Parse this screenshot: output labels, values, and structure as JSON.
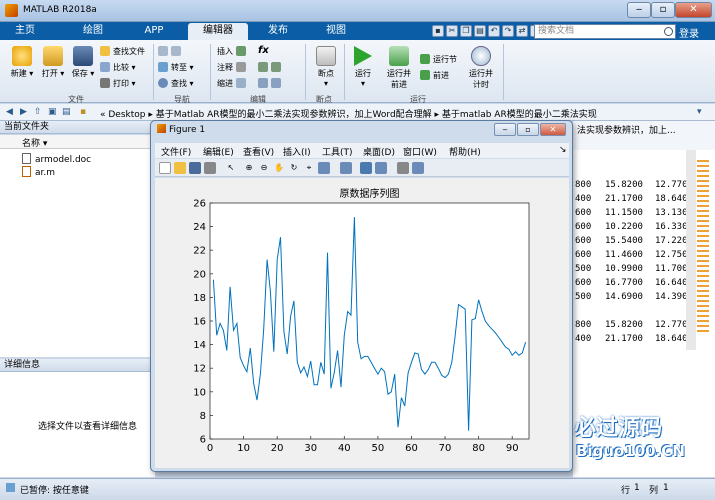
{
  "app": {
    "title": "MATLAB R2018a",
    "login": "登录",
    "search_placeholder": "搜索文档"
  },
  "tabs": [
    "主页",
    "绘图",
    "APP",
    "编辑器",
    "发布",
    "视图"
  ],
  "active_tab": "编辑器",
  "ribbon": {
    "new": "新建",
    "open": "打开",
    "save": "保存",
    "find_files": "查找文件",
    "compare": "比较",
    "print": "打印",
    "goto": "转至",
    "find": "查找",
    "insert": "插入",
    "comment": "注释",
    "indent": "缩进",
    "fx": "fx",
    "breakpoint": "断点",
    "run": "运行",
    "run_advance": "运行并\n前进",
    "run_section": "运行节",
    "advance": "前进",
    "run_time": "运行并\n计时",
    "groups": {
      "file": "文件",
      "nav": "导航",
      "edit": "编辑",
      "breakpoint": "断点",
      "run": "运行"
    }
  },
  "address": "« Desktop ▸ 基于Matlab AR模型的最小二乘法实现参数辨识，加上Word配合理解 ▸ 基于matlab AR模型的最小二乘法实现",
  "current_folder": {
    "title": "当前文件夹",
    "col_name": "名称 ▾",
    "files": [
      "armodel.doc",
      "ar.m"
    ]
  },
  "details": {
    "title": "详细信息",
    "message": "选择文件以查看详细信息"
  },
  "command_window": {
    "header": "法实现参数辨识，加上...",
    "rows": [
      [
        "800",
        "15.8200",
        "12.770"
      ],
      [
        "400",
        "21.1700",
        "18.640"
      ],
      [
        "600",
        "11.1500",
        "13.130"
      ],
      [
        "600",
        "10.2200",
        "16.330"
      ],
      [
        "600",
        "15.5400",
        "17.220"
      ],
      [
        "600",
        "11.4600",
        "12.750"
      ],
      [
        "500",
        "10.9900",
        "11.700"
      ],
      [
        "600",
        "16.7700",
        "16.640"
      ],
      [
        "500",
        "14.6900",
        "14.390"
      ],
      [
        "800",
        "15.8200",
        "12.770"
      ],
      [
        "400",
        "21.1700",
        "18.640"
      ]
    ]
  },
  "status": {
    "left": "已暂停: 按任意键",
    "row_label": "行",
    "row": "1",
    "col_label": "列",
    "col": "1"
  },
  "figure": {
    "title": "Figure 1",
    "menu": [
      "文件(F)",
      "编辑(E)",
      "查看(V)",
      "插入(I)",
      "工具(T)",
      "桌面(D)",
      "窗口(W)",
      "帮助(H)"
    ]
  },
  "watermark": {
    "title": "必过源码",
    "sub": "Biguo100.CN"
  },
  "chart_data": {
    "type": "line",
    "title": "原数据序列图",
    "xlabel": "",
    "ylabel": "",
    "xlim": [
      0,
      95
    ],
    "ylim": [
      6,
      26
    ],
    "xticks": [
      0,
      10,
      20,
      30,
      40,
      50,
      60,
      70,
      80,
      90
    ],
    "yticks": [
      6,
      8,
      10,
      12,
      14,
      16,
      18,
      20,
      22,
      24,
      26
    ],
    "color": "#0072bd",
    "x": [
      1,
      2,
      3,
      4,
      5,
      6,
      7,
      8,
      9,
      10,
      11,
      12,
      13,
      14,
      15,
      16,
      17,
      18,
      19,
      20,
      21,
      22,
      23,
      24,
      25,
      26,
      27,
      28,
      29,
      30,
      31,
      32,
      33,
      34,
      35,
      36,
      37,
      38,
      39,
      40,
      41,
      42,
      43,
      44,
      45,
      46,
      47,
      48,
      49,
      50,
      51,
      52,
      53,
      54,
      55,
      56,
      57,
      58,
      59,
      60,
      61,
      62,
      63,
      64,
      65,
      66,
      67,
      68,
      69,
      70,
      71,
      72,
      73,
      74,
      75,
      76,
      77,
      78,
      79,
      80,
      81,
      82,
      83,
      84,
      85,
      86,
      87,
      88,
      89,
      90,
      91,
      92,
      93,
      94
    ],
    "y": [
      19.5,
      14.8,
      15.8,
      15.2,
      13.5,
      18.9,
      15.2,
      15.8,
      12.9,
      12.2,
      11.7,
      13.7,
      10.7,
      9.3,
      11.5,
      15.3,
      21.2,
      18.5,
      13.4,
      21.2,
      23.1,
      15.1,
      13.2,
      16.4,
      17.7,
      12.5,
      11.6,
      12.1,
      11.3,
      12.6,
      10.6,
      10.6,
      12.5,
      11.5,
      21.8,
      10.3,
      11.6,
      13.5,
      10.4,
      14.8,
      16.8,
      16.5,
      24.8,
      14.2,
      12.8,
      13.0,
      13.0,
      12.5,
      12.0,
      11.5,
      12.0,
      11.7,
      9.8,
      10.0,
      11.5,
      7.0,
      9.5,
      8.8,
      11.6,
      12.5,
      13.3,
      13.2,
      11.9,
      11.5,
      11.9,
      12.5,
      12.5,
      12.0,
      11.4,
      11.2,
      11.5,
      12.5,
      14.7,
      17.4,
      17.2,
      17.0,
      6.7,
      16.1,
      16.2,
      17.8,
      16.8,
      16.0,
      15.6,
      15.3,
      15.0,
      14.6,
      14.2,
      13.8,
      13.6,
      13.1,
      13.4,
      13.1,
      13.3,
      14.2
    ]
  }
}
